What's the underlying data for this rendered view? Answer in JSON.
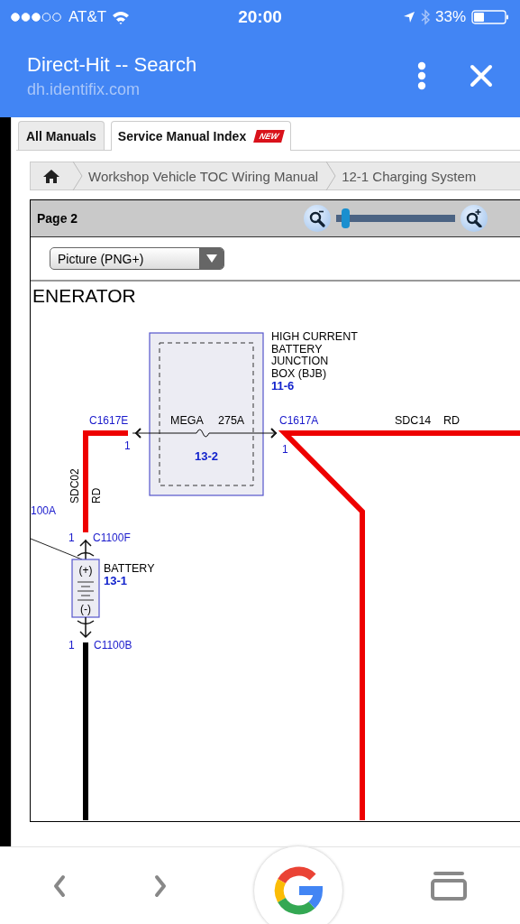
{
  "status_bar": {
    "carrier": "AT&T",
    "time": "20:00",
    "battery": "33%"
  },
  "header": {
    "title": "Direct-Hit -- Search",
    "url": "dh.identifix.com"
  },
  "tabs": [
    {
      "label": "All Manuals",
      "selected": false
    },
    {
      "label": "Service Manual Index",
      "selected": true,
      "badge": "NEW"
    }
  ],
  "breadcrumb": [
    "Workshop Vehicle TOC Wiring Manual",
    "12-1 Charging System"
  ],
  "viewer": {
    "page_label": "Page 2",
    "zoom": {
      "level": 0.05
    },
    "format": "Picture (PNG+)",
    "diagram": {
      "title": "ENERATOR",
      "junction_box": {
        "name": [
          "HIGH CURRENT",
          "BATTERY",
          "JUNCTION",
          "BOX (BJB)"
        ],
        "ref": "11-6",
        "fuse": "MEGA",
        "rating": "275A",
        "fuse_ref": "13-2"
      },
      "connectors": [
        {
          "id": "C1617E",
          "pin": "1"
        },
        {
          "id": "C1617A",
          "pin": "1"
        },
        {
          "id": "C1100F",
          "pin": "1"
        },
        {
          "id": "C1100B",
          "pin": "1"
        }
      ],
      "wires": [
        {
          "circuit": "SDC02",
          "color_code": "RD",
          "color": "#ee0000"
        },
        {
          "circuit": "SDC14",
          "color_code": "RD",
          "color": "#ee0000"
        }
      ],
      "battery": {
        "name": "BATTERY",
        "ref": "13-1",
        "positive": "(+)",
        "negative": "(-)"
      },
      "edge_label": "100A"
    }
  }
}
